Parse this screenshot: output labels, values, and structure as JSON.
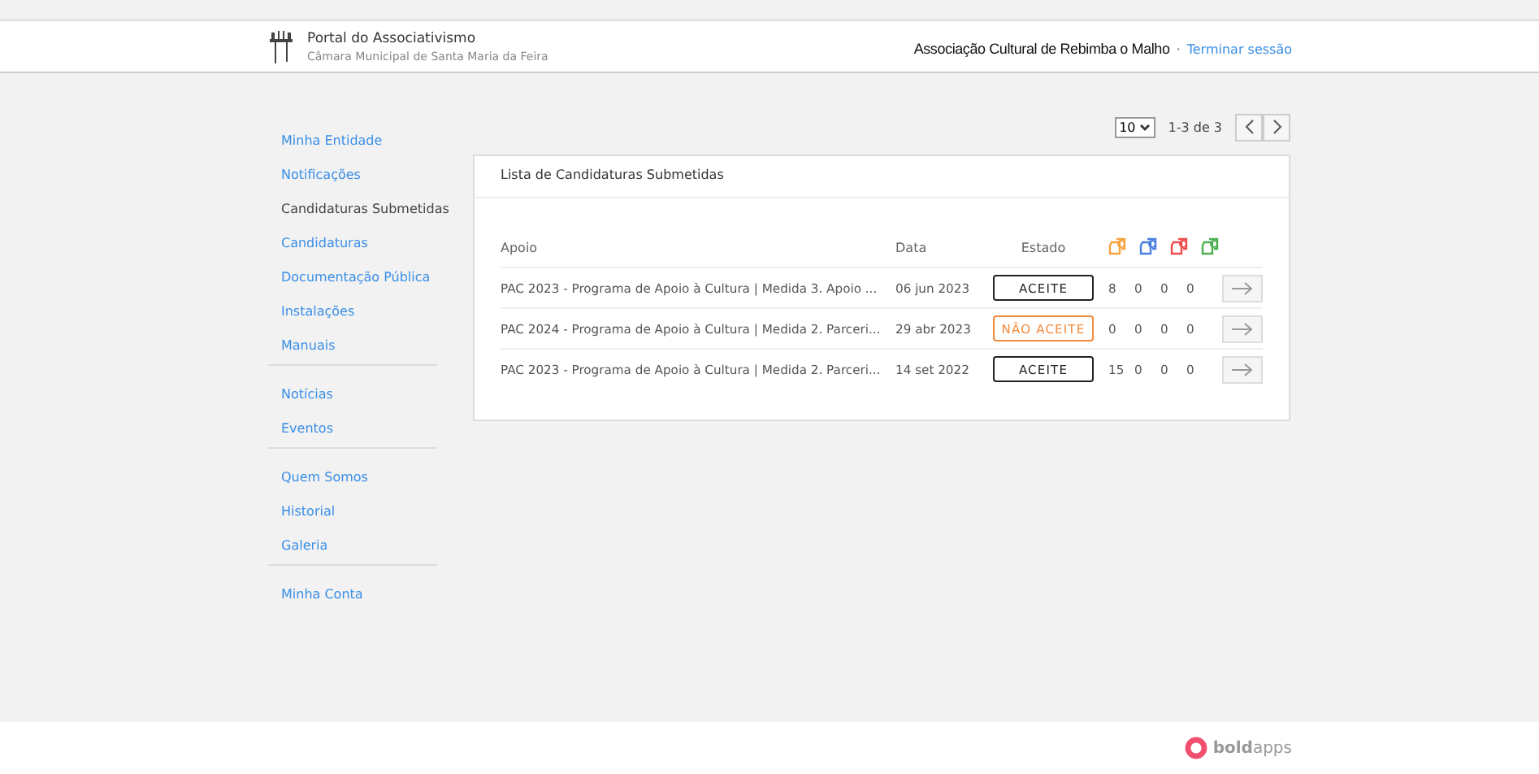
{
  "header": {
    "title": "Portal do Associativismo",
    "subtitle": "Câmara Municipal de Santa Maria da Feira",
    "entity": "Associação Cultural de Rebimba o Malho",
    "separator": "·",
    "logout": "Terminar sessão"
  },
  "sidebar": {
    "groups": [
      {
        "items": [
          {
            "label": "Minha Entidade",
            "selected": false
          },
          {
            "label": "Notificações",
            "selected": false
          },
          {
            "label": "Candidaturas Submetidas",
            "selected": true
          },
          {
            "label": "Candidaturas",
            "selected": false
          },
          {
            "label": "Documentação Pública",
            "selected": false
          },
          {
            "label": "Instalações",
            "selected": false
          },
          {
            "label": "Manuais",
            "selected": false
          }
        ]
      },
      {
        "items": [
          {
            "label": "Notícias",
            "selected": false
          },
          {
            "label": "Eventos",
            "selected": false
          }
        ]
      },
      {
        "items": [
          {
            "label": "Quem Somos",
            "selected": false
          },
          {
            "label": "Historial",
            "selected": false
          },
          {
            "label": "Galeria",
            "selected": false
          }
        ]
      },
      {
        "items": [
          {
            "label": "Minha Conta",
            "selected": false
          }
        ]
      }
    ]
  },
  "pagination": {
    "page_size": "10",
    "range": "1-3 de 3"
  },
  "panel": {
    "title": "Lista de Candidaturas Submetidas",
    "columns": [
      "Apoio",
      "Data",
      "Estado"
    ],
    "count_icons": [
      {
        "color": "#f5a340"
      },
      {
        "color": "#4a7fe0"
      },
      {
        "color": "#ee4b4b"
      },
      {
        "color": "#4caf50"
      }
    ],
    "rows": [
      {
        "apoio": "PAC 2023 - Programa de Apoio à Cultura | Medida 3. Apoio ...",
        "data": "06 jun 2023",
        "estado": "ACEITE",
        "kind": "accepted",
        "counts": [
          "8",
          "0",
          "0",
          "0"
        ]
      },
      {
        "apoio": "PAC 2024 - Programa de Apoio à Cultura | Medida 2. Parceri...",
        "data": "29 abr 2023",
        "estado": "NÃO ACEITE",
        "kind": "rejected",
        "counts": [
          "0",
          "0",
          "0",
          "0"
        ]
      },
      {
        "apoio": "PAC 2023 - Programa de Apoio à Cultura | Medida 2. Parceri...",
        "data": "14 set 2022",
        "estado": "ACEITE",
        "kind": "accepted",
        "counts": [
          "15",
          "0",
          "0",
          "0"
        ]
      }
    ]
  },
  "footer": {
    "logo": "**bold**apps"
  }
}
